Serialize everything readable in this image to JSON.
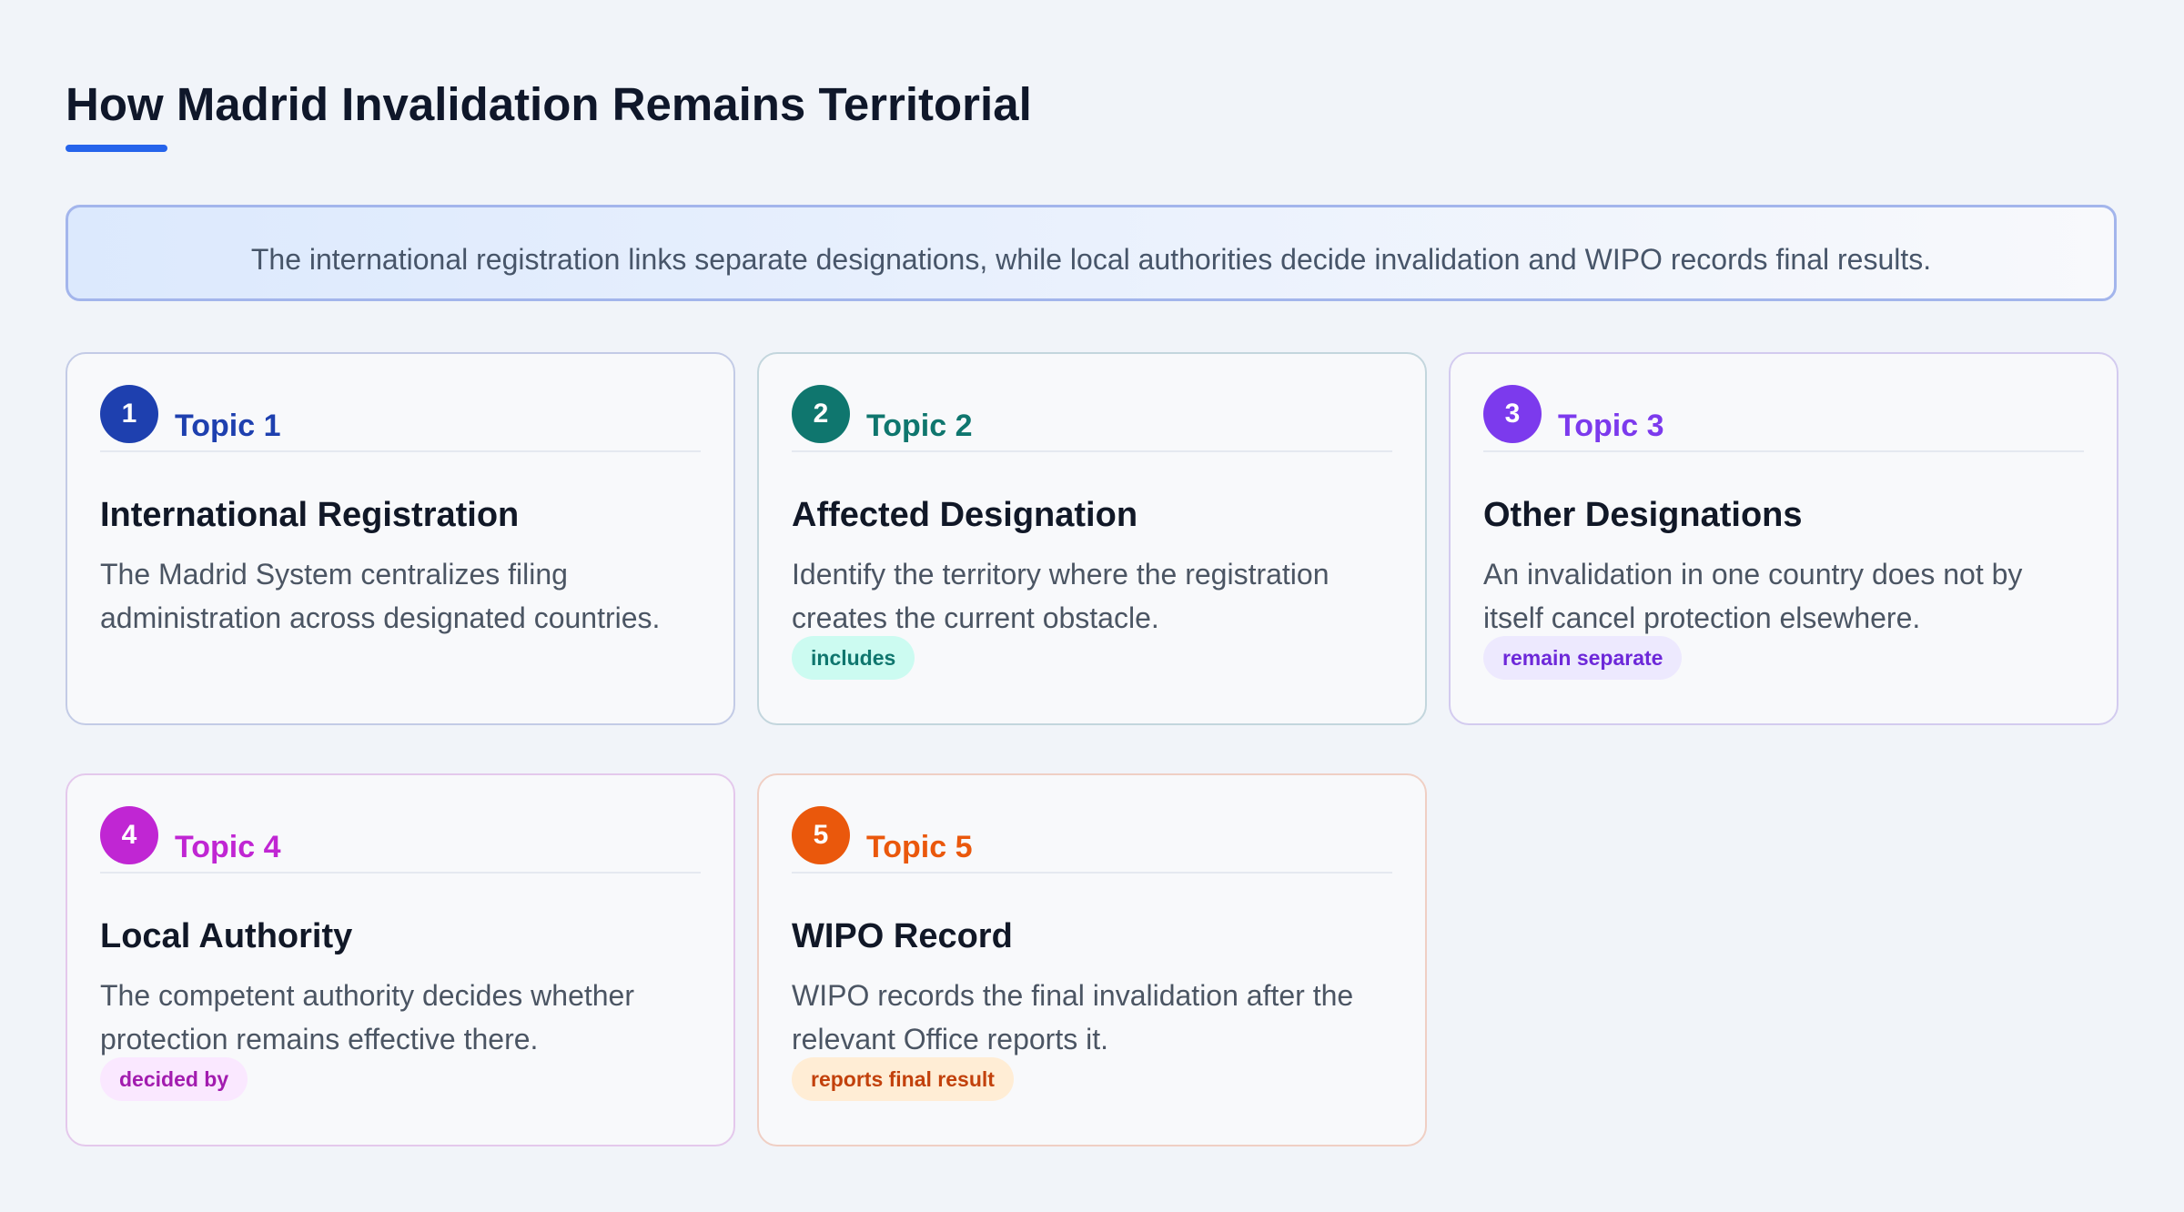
{
  "title": "How Madrid Invalidation Remains Territorial",
  "summary": "The international registration links separate designations, while local authorities decide invalidation and WIPO records final results.",
  "colors": {
    "accent": "#2563eb",
    "topic1": "#1e40af",
    "topic2": "#0f766e",
    "topic3": "#7c3aed",
    "topic4": "#c026d3",
    "topic5": "#ea580c"
  },
  "cards": [
    {
      "number": "1",
      "topic": "Topic 1",
      "title": "International Registration",
      "description": "The Madrid System centralizes filing administration across designated countries.",
      "tag": ""
    },
    {
      "number": "2",
      "topic": "Topic 2",
      "title": "Affected Designation",
      "description": "Identify the territory where the registration creates the current obstacle.",
      "tag": "includes"
    },
    {
      "number": "3",
      "topic": "Topic 3",
      "title": "Other Designations",
      "description": "An invalidation in one country does not by itself cancel protection elsewhere.",
      "tag": "remain separate"
    },
    {
      "number": "4",
      "topic": "Topic 4",
      "title": "Local Authority",
      "description": "The competent authority decides whether protection remains effective there.",
      "tag": "decided by"
    },
    {
      "number": "5",
      "topic": "Topic 5",
      "title": "WIPO Record",
      "description": "WIPO records the final invalidation after the relevant Office reports it.",
      "tag": "reports final result"
    }
  ]
}
